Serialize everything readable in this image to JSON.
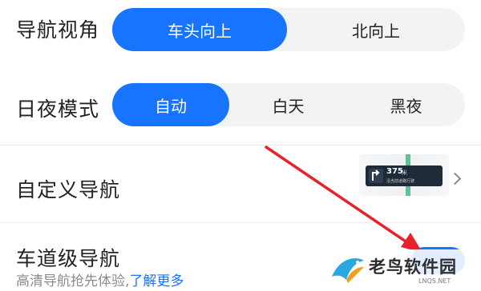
{
  "nav_view": {
    "label": "导航视角",
    "options": [
      "车头向上",
      "北向上"
    ],
    "selected": "车头向上"
  },
  "day_night": {
    "label": "日夜模式",
    "options": [
      "自动",
      "白天",
      "黑夜"
    ],
    "selected": "自动"
  },
  "custom_nav": {
    "label": "自定义导航",
    "preview": {
      "distance": "375",
      "unit": "米",
      "road_text": "沿当前道路行驶"
    }
  },
  "lane_nav": {
    "label": "车道级导航",
    "subtitle": "高清导航抢先体验,",
    "link": "了解更多",
    "enabled": true
  },
  "watermark": {
    "name": "老鸟软件园",
    "url": "LNQS.NET"
  },
  "colors": {
    "accent": "#1774ff",
    "annotation_arrow": "#e8212a"
  }
}
